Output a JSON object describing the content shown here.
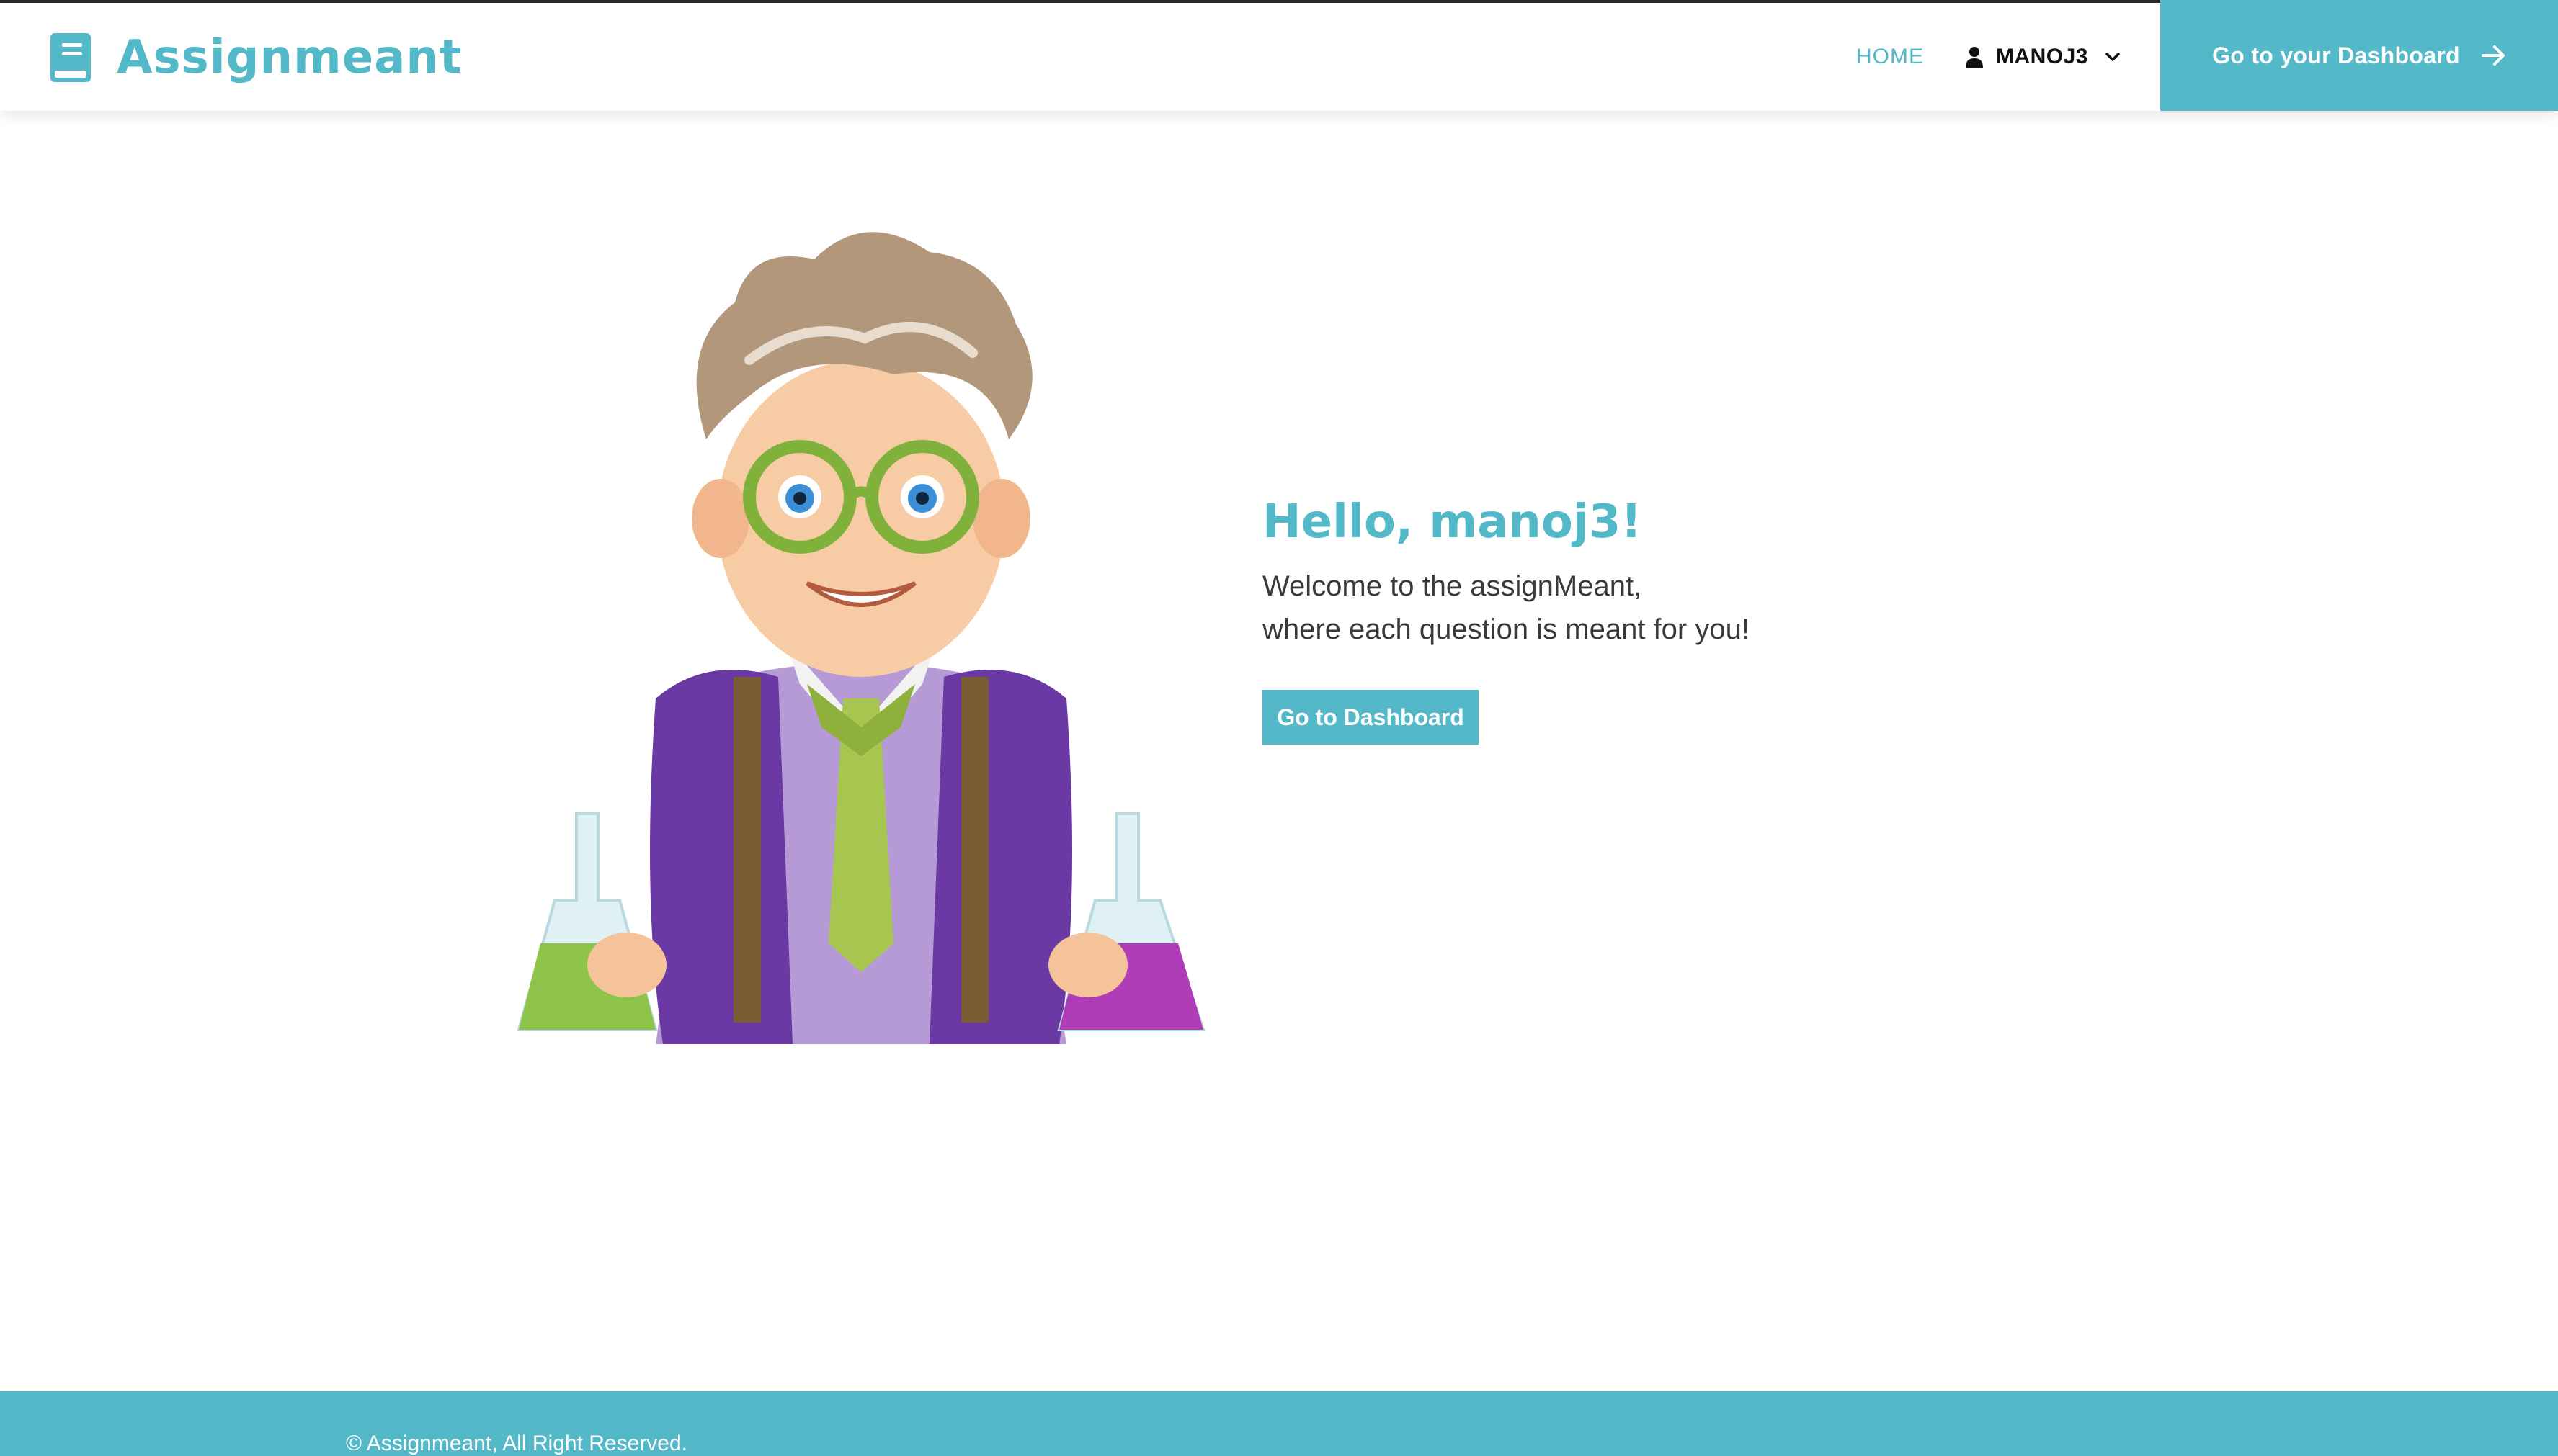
{
  "app": {
    "name": "Assignmeant"
  },
  "nav": {
    "home_label": "HOME",
    "user_label": "MANOJ3",
    "cta_label": "Go to your Dashboard"
  },
  "hero": {
    "greeting": "Hello, manoj3!",
    "welcome_line1": "Welcome to the assignMeant,",
    "welcome_line2": "where each question is meant for you!",
    "button_label": "Go to Dashboard"
  },
  "footer": {
    "copyright": "© Assignmeant, All Right Reserved."
  },
  "icons": {
    "brand": "book-icon",
    "user": "user-icon",
    "dropdown": "chevron-down-icon",
    "cta": "arrow-right-icon",
    "illustration": "scientist-boy-illustration"
  },
  "colors": {
    "accent": "#53b8c8",
    "text": "#333333"
  }
}
